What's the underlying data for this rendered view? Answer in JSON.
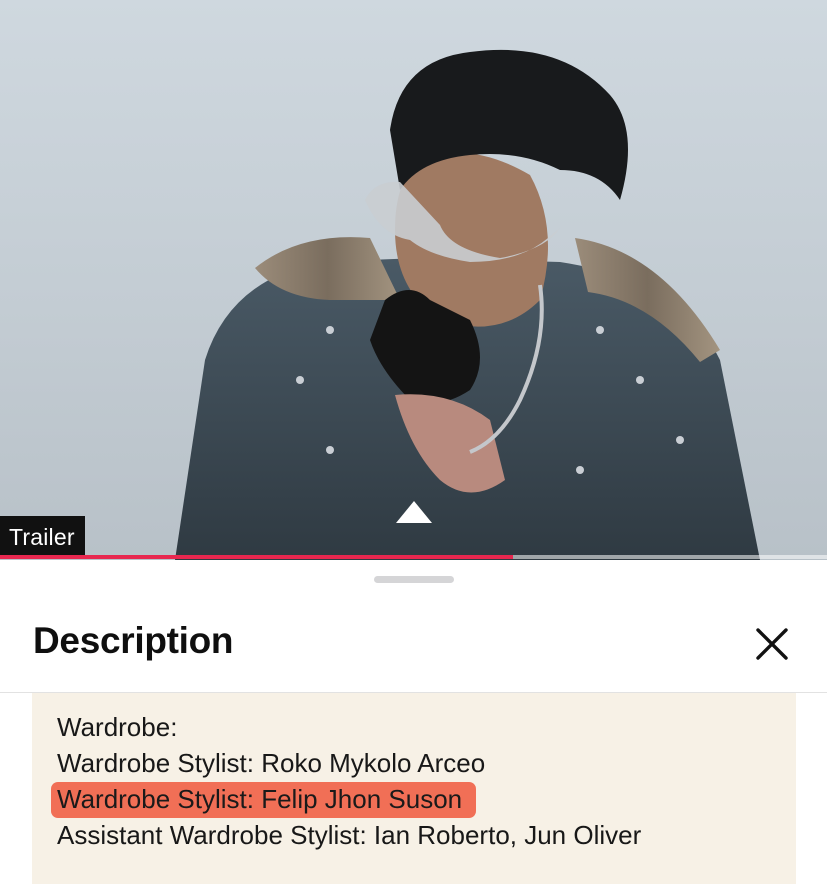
{
  "player": {
    "badge_label": "Trailer",
    "progress": 0.62,
    "colors": {
      "backdrop": "#c8d1d8",
      "progress": "#e8274f"
    },
    "icons": {
      "expand": "triangle-up-icon"
    }
  },
  "sheet": {
    "title": "Description",
    "close_icon": "close-icon",
    "background": "#f7f1e6",
    "lines": [
      "Wardrobe:",
      "Wardrobe Stylist: Roko Mykolo Arceo",
      "Wardrobe Stylist: Felip Jhon Suson",
      "Assistant Wardrobe Stylist: Ian Roberto, Jun Oliver"
    ],
    "highlighted_line_color": "#f05c42"
  }
}
